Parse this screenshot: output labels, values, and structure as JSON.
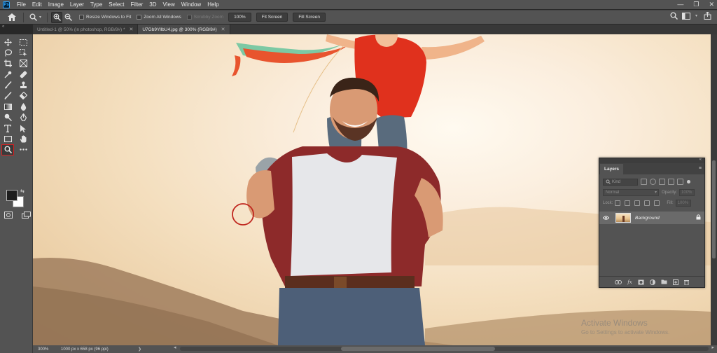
{
  "app": {
    "logo_text": "Ps"
  },
  "menubar": {
    "items": [
      "File",
      "Edit",
      "Image",
      "Layer",
      "Type",
      "Select",
      "Filter",
      "3D",
      "View",
      "Window",
      "Help"
    ],
    "window_controls": [
      "—",
      "❐",
      "✕"
    ]
  },
  "optionsbar": {
    "resize_windows_label": "Resize Windows to Fit",
    "zoom_all_label": "Zoom All Windows",
    "scrubby_zoom_label": "Scrubby Zoom",
    "zoom_value": "100%",
    "fit_screen_label": "Fit Screen",
    "fill_screen_label": "Fill Screen"
  },
  "tabs": [
    {
      "label": "Untitled-1 @ 50% (in photoshop, RGB/8#) *",
      "close": "✕",
      "active": false
    },
    {
      "label": "U7Gb9YllbU4.jpg @ 300% (RGB/8#)",
      "close": "✕",
      "active": true
    }
  ],
  "collapse_label": "«",
  "toolbar": {
    "tools": [
      "move-tool",
      "marquee-tool",
      "lasso-tool",
      "object-select-tool",
      "crop-tool",
      "frame-tool",
      "eyedropper-tool",
      "spot-heal-tool",
      "brush-tool",
      "stamp-tool",
      "history-brush-tool",
      "eraser-tool",
      "gradient-tool",
      "blur-tool",
      "dodge-tool",
      "pen-tool",
      "type-tool",
      "path-select-tool",
      "rectangle-tool",
      "hand-tool",
      "zoom-tool",
      "more-tools"
    ],
    "selected_tool": "zoom-tool",
    "swap_glyph": "⇆",
    "colors": {
      "foreground": "#1e1e1e",
      "background": "#ffffff",
      "selection_highlight": "#d81f1f"
    }
  },
  "watermark": {
    "line1": "Activate Windows",
    "line2": "Go to Settings to activate Windows."
  },
  "statusbar": {
    "zoom": "300%",
    "doc_info": "1000 px x 658 px (96 ppi)",
    "arrow": "❯",
    "left_arrow": "◂",
    "right_arrow": "▸"
  },
  "layers_panel": {
    "title": "Layers",
    "collapse": "«",
    "kind_label": "Kind",
    "blend_mode": "Normal",
    "opacity_label": "Opacity:",
    "opacity_value": "100%",
    "lock_label": "Lock:",
    "fill_label": "Fill:",
    "fill_value": "100%",
    "layer_name": "Background",
    "menu_glyph": "≡",
    "eye_glyph": "👁",
    "lock_glyph": "🔒",
    "bottom_icons": [
      "link",
      "fx",
      "mask",
      "adjustment",
      "group",
      "new-layer",
      "delete"
    ]
  }
}
